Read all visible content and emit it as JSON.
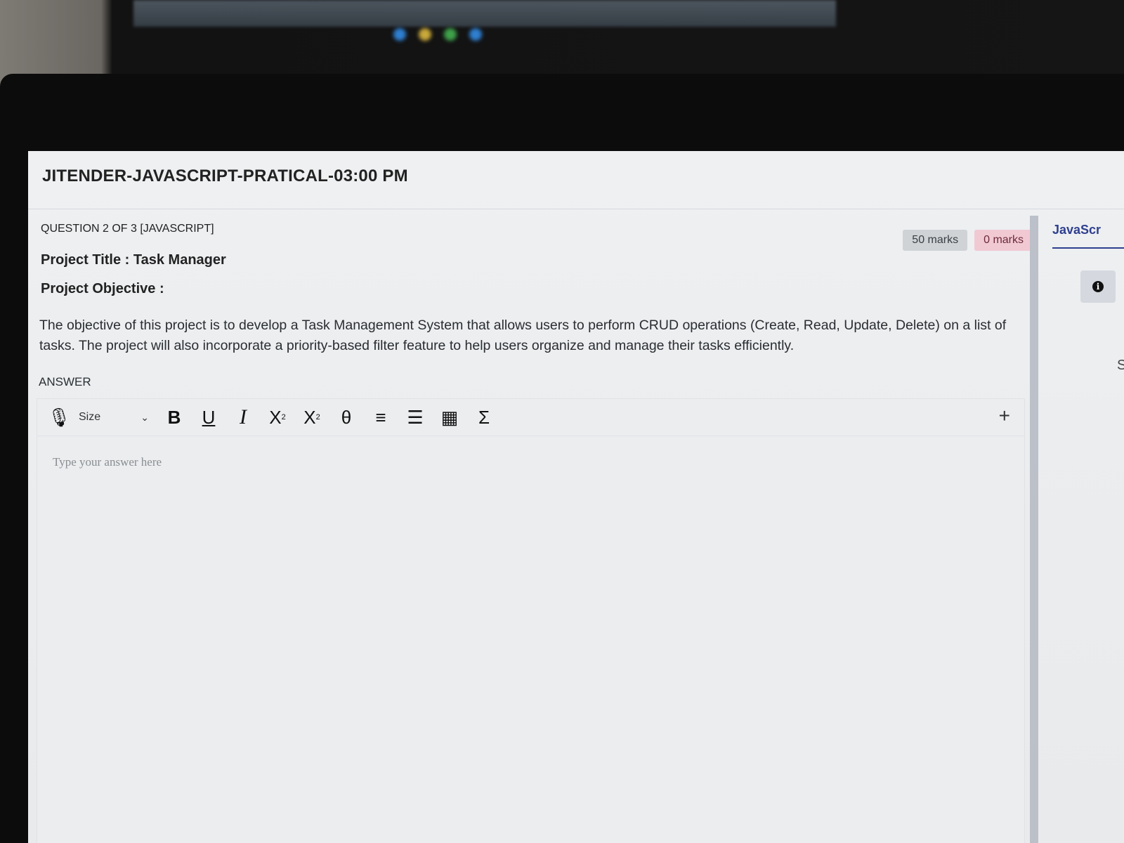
{
  "exam_title": "JITENDER-JAVASCRIPT-PRATICAL-03:00 PM",
  "question": {
    "label": "QUESTION 2 OF 3 [JAVASCRIPT]",
    "total_marks": "50 marks",
    "scored_marks": "0 marks",
    "project_title": "Project Title : Task Manager",
    "objective_label": "Project Objective :",
    "objective_text": "The objective of this project is to develop a Task Management System that allows users to perform CRUD operations (Create, Read, Update, Delete) on a list of tasks. The project will also incorporate a priority-based filter feature to help users organize and manage their tasks efficiently."
  },
  "answer": {
    "label": "ANSWER",
    "placeholder": "Type your answer here"
  },
  "toolbar": {
    "mic_icon": "🎙",
    "size_label": "Size",
    "chevron": "⌄",
    "bold": "B",
    "underline": "U",
    "italic": "I",
    "subscript_base": "X",
    "subscript_mark": "2",
    "superscript_base": "X",
    "superscript_mark": "2",
    "theta": "θ",
    "align": "≡",
    "list": "☰",
    "table": "▦",
    "sigma": "Σ",
    "plus": "+"
  },
  "side_panel": {
    "tab_label": "JavaScr",
    "info_glyph": "i",
    "partial_text": "Se"
  },
  "colors": {
    "accent": "#2f3f8f",
    "badge_total_bg": "#cfd3d6",
    "badge_scored_bg": "#f1c9d3"
  }
}
